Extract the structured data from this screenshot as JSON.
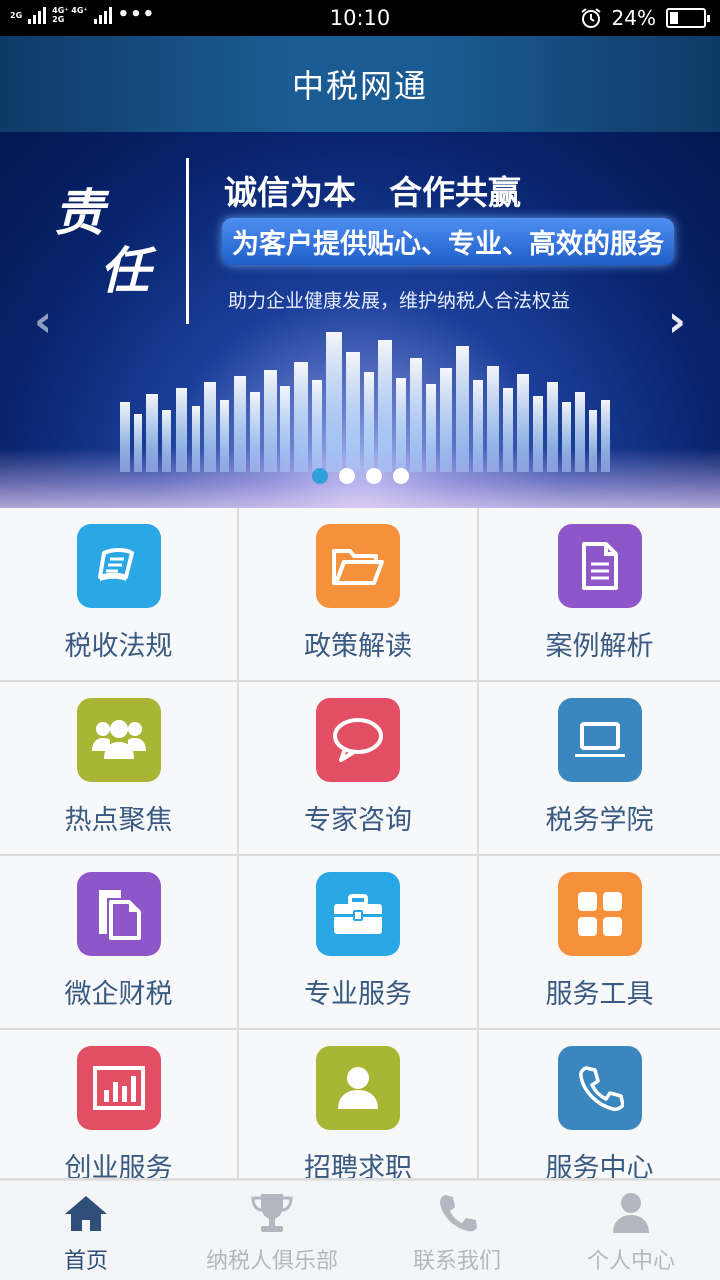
{
  "status_bar": {
    "sim1": "2G",
    "sim2_top": "4G⁺ 4G⁺",
    "sim2_bottom": "2G",
    "more": "•••",
    "time": "10:10",
    "battery": "24%",
    "battery_level": 0.24
  },
  "header": {
    "title": "中税网通"
  },
  "banner": {
    "calligraphy_1": "责",
    "calligraphy_2": "任",
    "line1": "诚信为本　合作共赢",
    "line2": "为客户提供贴心、专业、高效的服务",
    "line3": "助力企业健康发展，维护纳税人合法权益",
    "prev": "‹",
    "next": "›",
    "slides": 4,
    "active_slide": 1
  },
  "grid": [
    {
      "label": "税收法规",
      "icon": "book-icon",
      "color": "#2aa8e6"
    },
    {
      "label": "政策解读",
      "icon": "folder-icon",
      "color": "#f4913a"
    },
    {
      "label": "案例解析",
      "icon": "document-icon",
      "color": "#8e57c9"
    },
    {
      "label": "热点聚焦",
      "icon": "group-icon",
      "color": "#a9b534"
    },
    {
      "label": "专家咨询",
      "icon": "chat-bubble-icon",
      "color": "#e24f65"
    },
    {
      "label": "税务学院",
      "icon": "laptop-icon",
      "color": "#3a86bf"
    },
    {
      "label": "微企财税",
      "icon": "files-icon",
      "color": "#8e57c9"
    },
    {
      "label": "专业服务",
      "icon": "briefcase-icon",
      "color": "#2aa8e6"
    },
    {
      "label": "服务工具",
      "icon": "grid-icon",
      "color": "#f4913a"
    },
    {
      "label": "创业服务",
      "icon": "bar-chart-icon",
      "color": "#e24f65"
    },
    {
      "label": "招聘求职",
      "icon": "user-icon",
      "color": "#a9b534"
    },
    {
      "label": "服务中心",
      "icon": "phone-icon",
      "color": "#3a86bf"
    }
  ],
  "tabs": [
    {
      "label": "首页",
      "icon": "home-icon",
      "active": true
    },
    {
      "label": "纳税人俱乐部",
      "icon": "trophy-icon",
      "active": false
    },
    {
      "label": "联系我们",
      "icon": "phone-icon",
      "active": false
    },
    {
      "label": "个人中心",
      "icon": "person-icon",
      "active": false
    }
  ],
  "colors": {
    "header": "#1a5b93",
    "tab_active": "#2f4e78",
    "tab_inactive": "#b3b8c0",
    "label": "#3a5a82"
  }
}
